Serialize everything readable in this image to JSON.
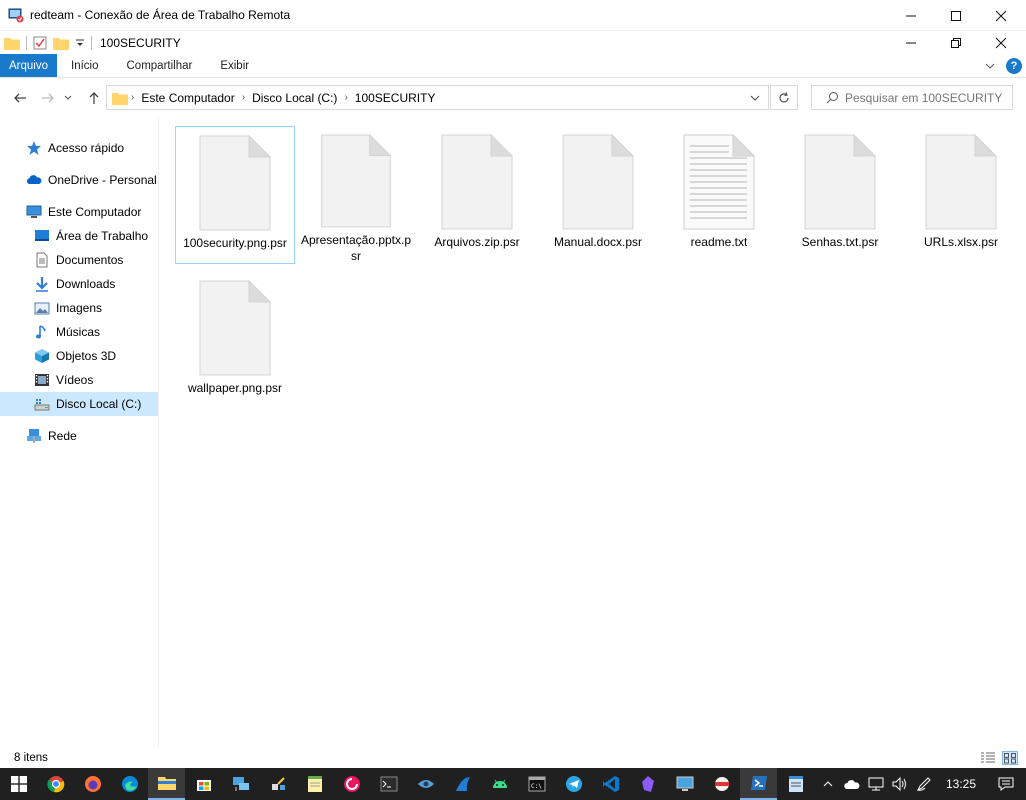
{
  "window": {
    "title": "redteam - Conexão de Área de Trabalho Remota"
  },
  "explorer": {
    "title": "100SECURITY",
    "ribbon_tabs": [
      "Arquivo",
      "Início",
      "Compartilhar",
      "Exibir"
    ],
    "breadcrumb": [
      "Este Computador",
      "Disco Local (C:)",
      "100SECURITY"
    ],
    "search_placeholder": "Pesquisar em 100SECURITY"
  },
  "sidebar": {
    "items": [
      {
        "label": "Acesso rápido",
        "icon": "star-icon"
      },
      {
        "label": "OneDrive - Personal",
        "icon": "cloud-icon"
      },
      {
        "label": "Este Computador",
        "icon": "computer-icon"
      },
      {
        "label": "Área de Trabalho",
        "icon": "desktop-icon"
      },
      {
        "label": "Documentos",
        "icon": "documents-icon"
      },
      {
        "label": "Downloads",
        "icon": "download-icon"
      },
      {
        "label": "Imagens",
        "icon": "images-icon"
      },
      {
        "label": "Músicas",
        "icon": "music-icon"
      },
      {
        "label": "Objetos 3D",
        "icon": "cube-icon"
      },
      {
        "label": "Vídeos",
        "icon": "video-icon"
      },
      {
        "label": "Disco Local (C:)",
        "icon": "drive-icon"
      },
      {
        "label": "Rede",
        "icon": "network-icon"
      }
    ]
  },
  "files": [
    {
      "name": "100security.png.psr",
      "icon": "blank-file-icon",
      "selected": true
    },
    {
      "name": "Apresentação.pptx.psr",
      "icon": "blank-file-icon"
    },
    {
      "name": "Arquivos.zip.psr",
      "icon": "blank-file-icon"
    },
    {
      "name": "Manual.docx.psr",
      "icon": "blank-file-icon"
    },
    {
      "name": "readme.txt",
      "icon": "text-file-icon"
    },
    {
      "name": "Senhas.txt.psr",
      "icon": "blank-file-icon"
    },
    {
      "name": "URLs.xlsx.psr",
      "icon": "blank-file-icon"
    },
    {
      "name": "wallpaper.png.psr",
      "icon": "blank-file-icon"
    }
  ],
  "status": {
    "item_count": "8 itens"
  },
  "taskbar": {
    "clock": "13:25"
  },
  "colors": {
    "accent": "#1979ca",
    "selection": "#cce8ff",
    "taskbar": "#202020"
  }
}
